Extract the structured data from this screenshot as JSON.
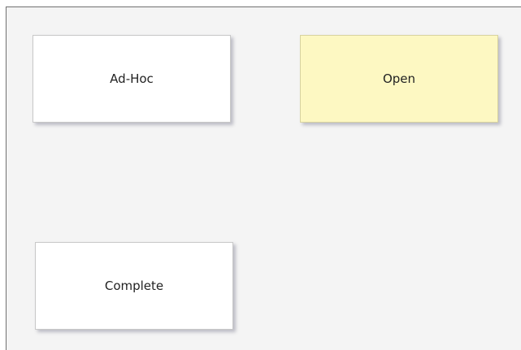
{
  "nodes": {
    "adhoc": {
      "label": "Ad-Hoc",
      "fill": "#ffffff"
    },
    "open": {
      "label": "Open",
      "fill": "#fdf8c2"
    },
    "complete": {
      "label": "Complete",
      "fill": "#ffffff"
    }
  },
  "colors": {
    "canvas_background": "#f4f4f4",
    "canvas_border": "#707070",
    "node_shadow": "#78788c"
  }
}
